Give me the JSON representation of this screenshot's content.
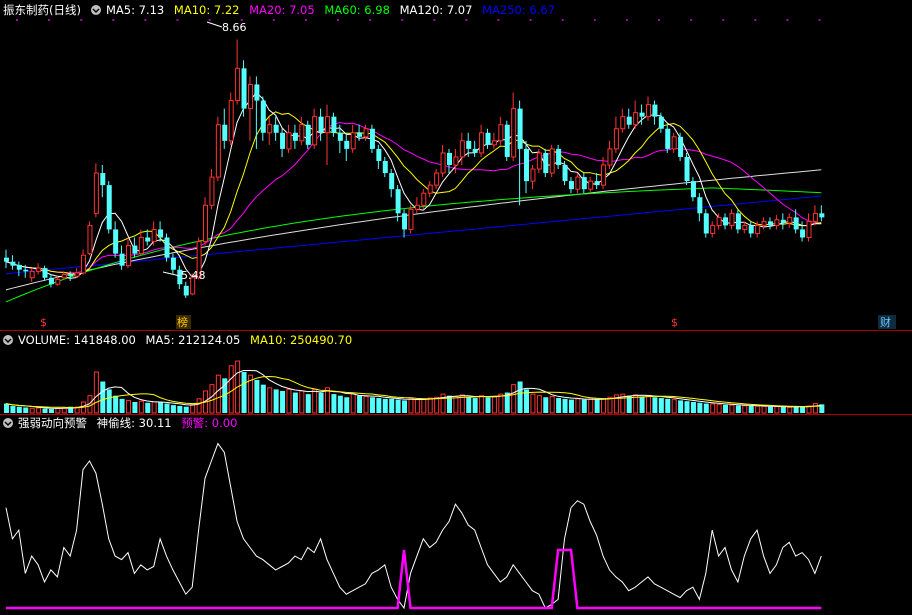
{
  "price_panel": {
    "stock_name": "振东制药(日线)",
    "indicators": [
      {
        "label": "MA5: 7.13",
        "color": "#ffffff"
      },
      {
        "label": "MA10: 7.22",
        "color": "#ffff00"
      },
      {
        "label": "MA20: 7.05",
        "color": "#ff00ff"
      },
      {
        "label": "MA60: 6.98",
        "color": "#00ff00"
      },
      {
        "label": "MA120: 7.07",
        "color": "#ffffff"
      },
      {
        "label": "MA250: 6.67",
        "color": "#0000ff"
      }
    ],
    "high_label": "8.66",
    "low_label": "5.48",
    "event_markers": [
      {
        "label": "$",
        "color": "#ff3333"
      },
      {
        "label": "榜",
        "color": "#ffcc00"
      },
      {
        "label": "$",
        "color": "#ff3333"
      },
      {
        "label": "财",
        "color": "#66ccff"
      }
    ]
  },
  "volume_panel": {
    "items": [
      {
        "label": "VOLUME: 141848.00",
        "color": "#ffffff"
      },
      {
        "label": "MA5: 212124.05",
        "color": "#ffffff"
      },
      {
        "label": "MA10: 250490.70",
        "color": "#ffff00"
      }
    ]
  },
  "indicator_panel": {
    "items": [
      {
        "label": "强弱动向预警",
        "color": "#ffffff"
      },
      {
        "label": "神偷线: 30.11",
        "color": "#ffffff"
      },
      {
        "label": "预警: 0.00",
        "color": "#ff00ff"
      }
    ]
  },
  "colors": {
    "background": "#000000",
    "up_candle": "#ff3232",
    "down_candle": "#54ffff",
    "panel_border": "#b00000",
    "ma5": "#ffffff",
    "ma10": "#ffff00",
    "ma20": "#ff00ff",
    "ma60": "#00ff00",
    "ma120": "#ffffff",
    "ma250": "#0000ff",
    "signal_line": "#ffffff",
    "alert_line": "#ff00ff"
  },
  "chart_data": [
    {
      "type": "candlestick",
      "title": "振东制药(日线)",
      "ylim": [
        5.3,
        8.9
      ],
      "candles": [
        [
          5.95,
          5.9,
          6.05,
          5.82
        ],
        [
          5.9,
          5.85,
          5.98,
          5.8
        ],
        [
          5.86,
          5.8,
          5.9,
          5.72
        ],
        [
          5.8,
          5.78,
          5.86,
          5.7
        ],
        [
          5.7,
          5.78,
          5.82,
          5.65
        ],
        [
          5.78,
          5.82,
          5.88,
          5.74
        ],
        [
          5.82,
          5.7,
          5.85,
          5.66
        ],
        [
          5.7,
          5.62,
          5.74,
          5.58
        ],
        [
          5.62,
          5.68,
          5.72,
          5.6
        ],
        [
          5.7,
          5.74,
          5.78,
          5.68
        ],
        [
          5.74,
          5.72,
          5.78,
          5.66
        ],
        [
          5.72,
          5.76,
          5.82,
          5.7
        ],
        [
          5.76,
          5.98,
          6.05,
          5.74
        ],
        [
          6.0,
          6.35,
          6.4,
          5.98
        ],
        [
          6.5,
          7.0,
          7.12,
          6.45
        ],
        [
          7.0,
          6.85,
          7.1,
          6.7
        ],
        [
          6.85,
          6.3,
          6.9,
          6.25
        ],
        [
          6.3,
          6.0,
          6.4,
          5.95
        ],
        [
          6.0,
          5.85,
          6.1,
          5.8
        ],
        [
          5.85,
          6.1,
          6.2,
          5.82
        ],
        [
          6.1,
          6.0,
          6.2,
          5.95
        ],
        [
          6.0,
          6.2,
          6.3,
          5.98
        ],
        [
          6.2,
          6.15,
          6.3,
          6.1
        ],
        [
          6.15,
          6.3,
          6.4,
          6.1
        ],
        [
          6.3,
          6.2,
          6.4,
          6.15
        ],
        [
          6.2,
          5.95,
          6.25,
          5.9
        ],
        [
          5.95,
          5.8,
          6.0,
          5.75
        ],
        [
          5.8,
          5.62,
          5.85,
          5.56
        ],
        [
          5.6,
          5.48,
          5.65,
          5.45
        ],
        [
          5.5,
          5.7,
          5.75,
          5.48
        ],
        [
          5.7,
          6.15,
          6.2,
          5.68
        ],
        [
          6.15,
          6.6,
          6.7,
          6.1
        ],
        [
          6.6,
          6.95,
          7.05,
          6.55
        ],
        [
          6.95,
          7.6,
          7.7,
          6.9
        ],
        [
          7.6,
          7.4,
          7.8,
          7.3
        ],
        [
          7.4,
          7.9,
          8.0,
          7.35
        ],
        [
          7.9,
          8.3,
          8.66,
          7.85
        ],
        [
          8.3,
          7.8,
          8.4,
          7.7
        ],
        [
          7.8,
          8.1,
          8.2,
          7.4
        ],
        [
          8.1,
          7.9,
          8.2,
          7.3
        ],
        [
          7.9,
          7.5,
          7.95,
          7.4
        ],
        [
          7.5,
          7.6,
          7.7,
          7.35
        ],
        [
          7.6,
          7.5,
          7.7,
          7.4
        ],
        [
          7.5,
          7.3,
          7.55,
          7.2
        ],
        [
          7.3,
          7.5,
          7.6,
          7.25
        ],
        [
          7.5,
          7.4,
          7.6,
          7.3
        ],
        [
          7.4,
          7.6,
          7.7,
          7.35
        ],
        [
          7.6,
          7.35,
          7.65,
          7.3
        ],
        [
          7.35,
          7.7,
          7.8,
          7.3
        ],
        [
          7.7,
          7.5,
          7.8,
          7.4
        ],
        [
          7.5,
          7.7,
          7.85,
          7.1
        ],
        [
          7.7,
          7.5,
          7.75,
          7.45
        ],
        [
          7.5,
          7.4,
          7.6,
          7.25
        ],
        [
          7.4,
          7.3,
          7.5,
          7.15
        ],
        [
          7.3,
          7.5,
          7.6,
          7.25
        ],
        [
          7.5,
          7.45,
          7.6,
          7.4
        ],
        [
          7.45,
          7.55,
          7.6,
          7.4
        ],
        [
          7.55,
          7.3,
          7.6,
          7.25
        ],
        [
          7.3,
          7.15,
          7.35,
          7.05
        ],
        [
          7.15,
          7.0,
          7.2,
          6.95
        ],
        [
          7.0,
          6.8,
          7.05,
          6.7
        ],
        [
          6.8,
          6.5,
          6.85,
          6.4
        ],
        [
          6.5,
          6.3,
          6.55,
          6.2
        ],
        [
          6.3,
          6.55,
          6.6,
          6.25
        ],
        [
          6.55,
          6.6,
          6.7,
          6.5
        ],
        [
          6.6,
          6.75,
          6.8,
          6.55
        ],
        [
          6.75,
          6.85,
          6.9,
          6.7
        ],
        [
          6.85,
          7.0,
          7.05,
          6.8
        ],
        [
          7.0,
          7.25,
          7.35,
          6.95
        ],
        [
          7.25,
          7.1,
          7.3,
          7.0
        ],
        [
          7.1,
          7.2,
          7.3,
          7.0
        ],
        [
          7.2,
          7.4,
          7.5,
          7.1
        ],
        [
          7.4,
          7.3,
          7.5,
          7.2
        ],
        [
          7.3,
          7.25,
          7.4,
          7.2
        ],
        [
          7.25,
          7.5,
          7.6,
          7.2
        ],
        [
          7.5,
          7.35,
          7.55,
          7.3
        ],
        [
          7.35,
          7.4,
          7.5,
          7.3
        ],
        [
          7.4,
          7.6,
          7.7,
          7.35
        ],
        [
          7.6,
          7.2,
          7.65,
          7.15
        ],
        [
          7.2,
          7.8,
          8.0,
          7.15
        ],
        [
          7.8,
          7.3,
          7.9,
          6.6
        ],
        [
          7.3,
          6.9,
          7.4,
          6.75
        ],
        [
          6.9,
          7.05,
          7.1,
          6.8
        ],
        [
          7.05,
          7.25,
          7.3,
          7.0
        ],
        [
          7.25,
          7.0,
          7.3,
          6.95
        ],
        [
          7.0,
          7.3,
          7.35,
          6.95
        ],
        [
          7.3,
          7.1,
          7.35,
          7.05
        ],
        [
          7.1,
          6.9,
          7.15,
          6.85
        ],
        [
          6.9,
          6.8,
          6.95,
          6.75
        ],
        [
          6.8,
          6.95,
          7.0,
          6.75
        ],
        [
          6.95,
          6.8,
          7.0,
          6.75
        ],
        [
          6.8,
          6.9,
          6.95,
          6.75
        ],
        [
          6.9,
          6.85,
          7.0,
          6.8
        ],
        [
          6.85,
          7.1,
          7.2,
          6.8
        ],
        [
          7.1,
          7.3,
          7.4,
          7.05
        ],
        [
          7.3,
          7.55,
          7.7,
          7.25
        ],
        [
          7.55,
          7.7,
          7.8,
          7.5
        ],
        [
          7.7,
          7.6,
          7.8,
          7.55
        ],
        [
          7.6,
          7.75,
          7.9,
          7.55
        ],
        [
          7.75,
          7.7,
          7.85,
          7.6
        ],
        [
          7.7,
          7.85,
          7.95,
          7.65
        ],
        [
          7.85,
          7.7,
          7.9,
          7.6
        ],
        [
          7.7,
          7.55,
          7.75,
          7.5
        ],
        [
          7.55,
          7.3,
          7.6,
          7.25
        ],
        [
          7.3,
          7.45,
          7.5,
          7.25
        ],
        [
          7.45,
          7.2,
          7.5,
          7.15
        ],
        [
          7.2,
          6.9,
          7.25,
          6.85
        ],
        [
          6.9,
          6.7,
          6.95,
          6.65
        ],
        [
          6.7,
          6.5,
          6.75,
          6.4
        ],
        [
          6.5,
          6.25,
          6.55,
          6.2
        ],
        [
          6.25,
          6.35,
          6.4,
          6.2
        ],
        [
          6.35,
          6.45,
          6.5,
          6.3
        ],
        [
          6.45,
          6.35,
          6.5,
          6.3
        ],
        [
          6.35,
          6.5,
          6.55,
          6.3
        ],
        [
          6.5,
          6.3,
          6.55,
          6.25
        ],
        [
          6.3,
          6.35,
          6.4,
          6.25
        ],
        [
          6.35,
          6.25,
          6.4,
          6.2
        ],
        [
          6.25,
          6.35,
          6.4,
          6.2
        ],
        [
          6.35,
          6.4,
          6.45,
          6.3
        ],
        [
          6.4,
          6.35,
          6.45,
          6.3
        ],
        [
          6.35,
          6.42,
          6.48,
          6.3
        ],
        [
          6.42,
          6.38,
          6.5,
          6.3
        ],
        [
          6.38,
          6.45,
          6.5,
          6.32
        ],
        [
          6.45,
          6.3,
          6.55,
          6.25
        ],
        [
          6.3,
          6.2,
          6.4,
          6.15
        ],
        [
          6.2,
          6.4,
          6.5,
          6.15
        ],
        [
          6.4,
          6.5,
          6.6,
          6.35
        ],
        [
          6.5,
          6.45,
          6.6,
          6.4
        ]
      ],
      "ma_last": {
        "MA5": 7.13,
        "MA10": 7.22,
        "MA20": 7.05,
        "MA60": 6.98,
        "MA120": 7.07,
        "MA250": 6.67
      }
    },
    {
      "type": "bar",
      "title": "VOLUME",
      "ylim": [
        0,
        1000
      ],
      "values": [
        60,
        45,
        40,
        35,
        30,
        32,
        28,
        25,
        30,
        35,
        40,
        38,
        70,
        110,
        260,
        200,
        150,
        110,
        90,
        80,
        70,
        75,
        65,
        70,
        68,
        60,
        50,
        45,
        40,
        55,
        90,
        140,
        180,
        240,
        220,
        300,
        330,
        260,
        240,
        210,
        180,
        160,
        150,
        140,
        150,
        130,
        140,
        120,
        150,
        130,
        160,
        120,
        110,
        100,
        120,
        110,
        105,
        100,
        95,
        90,
        90,
        85,
        80,
        90,
        85,
        90,
        95,
        100,
        120,
        110,
        105,
        115,
        100,
        95,
        110,
        100,
        105,
        120,
        130,
        180,
        200,
        150,
        120,
        110,
        100,
        105,
        95,
        90,
        85,
        90,
        85,
        88,
        86,
        90,
        100,
        115,
        120,
        110,
        115,
        105,
        110,
        100,
        95,
        90,
        85,
        80,
        75,
        70,
        65,
        60,
        58,
        55,
        52,
        50,
        48,
        46,
        45,
        44,
        42,
        40,
        40,
        38,
        36,
        40,
        42,
        45,
        60,
        55
      ],
      "ma_last": {
        "MA5": 212124.05,
        "MA10": 250490.7
      }
    },
    {
      "type": "line",
      "title": "强弱动向预警",
      "ylim": [
        0,
        100
      ],
      "series": [
        {
          "name": "神偷线",
          "values": [
            58,
            40,
            45,
            20,
            30,
            25,
            15,
            22,
            18,
            35,
            30,
            45,
            80,
            85,
            78,
            60,
            40,
            30,
            28,
            32,
            20,
            25,
            22,
            24,
            40,
            30,
            22,
            15,
            8,
            12,
            45,
            75,
            85,
            95,
            90,
            70,
            50,
            40,
            35,
            30,
            28,
            25,
            22,
            24,
            26,
            30,
            28,
            35,
            32,
            40,
            28,
            20,
            12,
            8,
            10,
            12,
            14,
            20,
            22,
            25,
            12,
            5,
            0,
            20,
            30,
            40,
            35,
            38,
            45,
            50,
            60,
            55,
            48,
            45,
            35,
            25,
            20,
            15,
            18,
            25,
            20,
            15,
            10,
            8,
            0,
            2,
            5,
            40,
            58,
            62,
            60,
            50,
            42,
            30,
            22,
            18,
            15,
            10,
            12,
            15,
            18,
            14,
            12,
            10,
            8,
            6,
            10,
            12,
            5,
            20,
            45,
            30,
            35,
            22,
            15,
            30,
            40,
            45,
            30,
            20,
            25,
            35,
            38,
            30,
            32,
            28,
            20,
            30
          ]
        },
        {
          "name": "预警",
          "values": [
            0,
            0,
            0,
            0,
            0,
            0,
            0,
            0,
            0,
            0,
            0,
            0,
            0,
            0,
            0,
            0,
            0,
            0,
            0,
            0,
            0,
            0,
            0,
            0,
            0,
            0,
            0,
            0,
            0,
            0,
            0,
            0,
            0,
            0,
            0,
            0,
            0,
            0,
            0,
            0,
            0,
            0,
            0,
            0,
            0,
            0,
            0,
            0,
            0,
            0,
            0,
            0,
            0,
            0,
            0,
            0,
            0,
            0,
            0,
            0,
            0,
            0,
            100,
            0,
            0,
            0,
            0,
            0,
            0,
            0,
            0,
            0,
            0,
            0,
            0,
            0,
            0,
            0,
            0,
            0,
            0,
            0,
            0,
            0,
            0,
            0,
            100,
            100,
            100,
            0,
            0,
            0,
            0,
            0,
            0,
            0,
            0,
            0,
            0,
            0,
            0,
            0,
            0,
            0,
            0,
            0,
            0,
            0,
            0,
            0,
            0,
            0,
            0,
            0,
            0,
            0,
            0,
            0,
            0,
            0,
            0,
            0,
            0,
            0,
            0,
            0,
            0,
            0
          ]
        }
      ]
    }
  ]
}
